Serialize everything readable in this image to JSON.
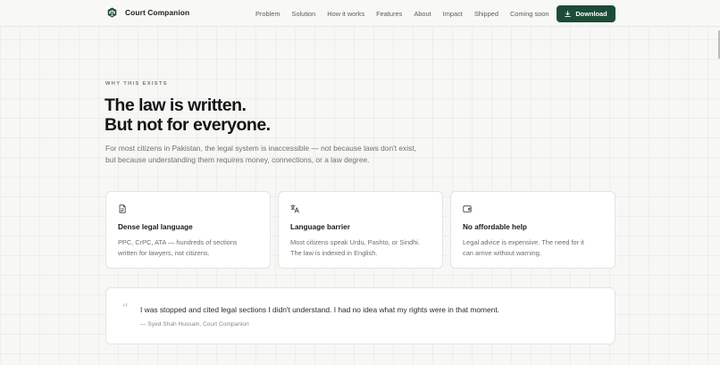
{
  "nav": {
    "brand": "Court Companion",
    "links": [
      "Problem",
      "Solution",
      "How it works",
      "Features",
      "About",
      "Impact",
      "Shipped",
      "Coming soon"
    ],
    "download_label": "Download"
  },
  "hero": {
    "eyebrow": "WHY THIS EXISTS",
    "headline_lines": [
      "The law is written.",
      "But not for everyone."
    ],
    "intro_lines": [
      "For most citizens in Pakistan, the legal system is inaccessible — not because laws don't exist,",
      "but because understanding them requires money, connections, or a law degree."
    ]
  },
  "cards": [
    {
      "icon": "document-icon",
      "title": "Dense legal language",
      "body_lines": [
        "PPC, CrPC, ATA — hundreds of sections",
        "written for lawyers, not citizens."
      ]
    },
    {
      "icon": "translate-icon",
      "title": "Language barrier",
      "body_lines": [
        "Most citizens speak Urdu, Pashto, or Sindhi.",
        "The law is indexed in English."
      ]
    },
    {
      "icon": "wallet-icon",
      "title": "No affordable help",
      "body_lines": [
        "Legal advice is expensive. The need for it",
        "can arrive without warning."
      ]
    }
  ],
  "quote": {
    "mark": "“",
    "text": "I was stopped and cited legal sections I didn't understand. I had no idea what my rights were in that moment.",
    "attribution": "— Syed Shah Hussain, Court Companion"
  },
  "colors": {
    "accent": "#1c4c35",
    "background": "#f7f7f5",
    "card": "#ffffff"
  }
}
